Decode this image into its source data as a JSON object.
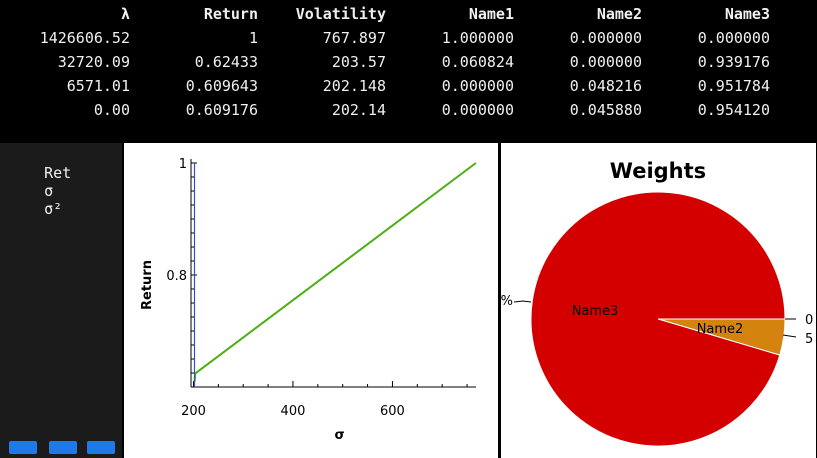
{
  "table": {
    "headers": [
      "λ",
      "Return",
      "Volatility",
      "Name1",
      "Name2",
      "Name3"
    ],
    "rows": [
      [
        "1426606.52",
        "1",
        "767.897",
        "1.000000",
        "0.000000",
        "0.000000"
      ],
      [
        "32720.09",
        "0.62433",
        "203.57",
        "0.060824",
        "0.000000",
        "0.939176"
      ],
      [
        "6571.01",
        "0.609643",
        "202.148",
        "0.000000",
        "0.048216",
        "0.951784"
      ],
      [
        "0.00",
        "0.609176",
        "202.14",
        "0.000000",
        "0.045880",
        "0.954120"
      ]
    ]
  },
  "side_panel": {
    "headers": [
      "Ret",
      "σ",
      "σ²"
    ],
    "buttons": [
      "btn-1",
      "btn-2",
      "btn-3"
    ],
    "button_color": "#1f7ae8"
  },
  "chart_data": [
    {
      "type": "line",
      "xlabel": "σ",
      "ylabel": "Return",
      "xlim": [
        195,
        768
      ],
      "ylim": [
        0.6,
        1.0
      ],
      "xticks": [
        "200",
        "400",
        "600"
      ],
      "yticks": [
        "1",
        "0.8"
      ],
      "series": [
        {
          "points": [
            [
              202.14,
              0.6092
            ],
            [
              203.57,
              0.6243
            ],
            [
              767.897,
              1.0
            ]
          ],
          "color": "#4caf10"
        },
        {
          "points": [
            [
              202.0,
              0.6
            ],
            [
              202.0,
              1.0
            ]
          ],
          "color": "#3050c8"
        }
      ]
    },
    {
      "type": "pie",
      "title": "Weights",
      "slices": [
        {
          "label": "Name3",
          "value": 95.412,
          "color": "#d40000"
        },
        {
          "label": "Name2",
          "value": 4.588,
          "color": "#d4830f"
        },
        {
          "label": "",
          "value": 0.0001,
          "color": "#d4830f"
        }
      ],
      "outside_labels": [
        "%",
        "0",
        "5"
      ]
    }
  ]
}
